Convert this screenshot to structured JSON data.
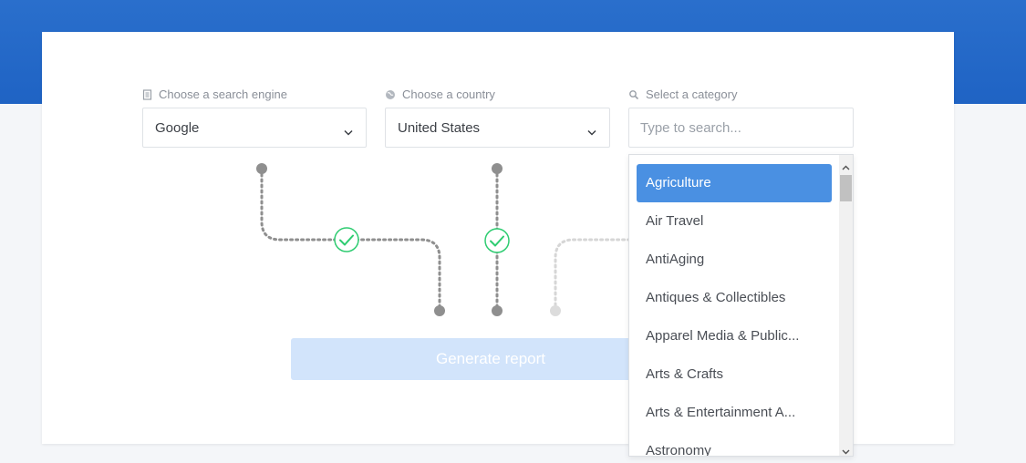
{
  "fields": {
    "engine": {
      "label": "Choose a search engine",
      "value": "Google"
    },
    "country": {
      "label": "Choose a country",
      "value": "United States"
    },
    "category": {
      "label": "Select a category",
      "placeholder": "Type to search..."
    }
  },
  "generate_button": {
    "label": "Generate report"
  },
  "dropdown": {
    "options": [
      "Agriculture",
      "Air Travel",
      "AntiAging",
      "Antiques & Collectibles",
      "Apparel Media & Public...",
      "Arts & Crafts",
      "Arts & Entertainment A...",
      "Astronomy"
    ],
    "selected": "Agriculture"
  },
  "colors": {
    "header_blue": "#2a6fcc",
    "check_green": "#2ecc71",
    "selected_option": "#4a90e2",
    "button_disabled": "#d2e4fb"
  },
  "icons": {
    "engine": "document-icon",
    "country": "globe-icon",
    "category": "magnifier-icon",
    "steps_complete": "checkmark-icon"
  }
}
